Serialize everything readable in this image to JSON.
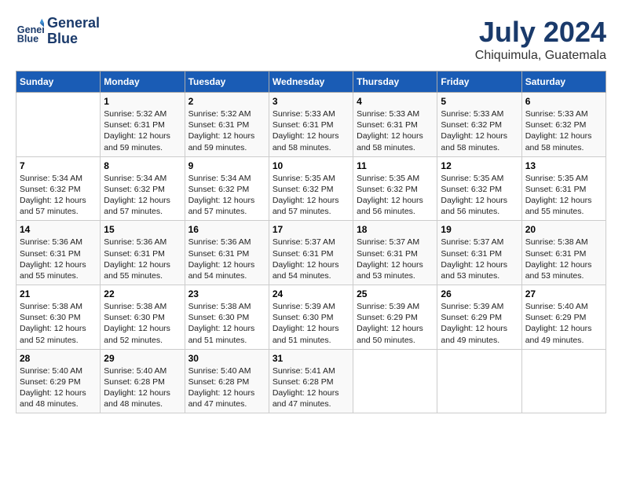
{
  "header": {
    "logo_line1": "General",
    "logo_line2": "Blue",
    "month_title": "July 2024",
    "location": "Chiquimula, Guatemala"
  },
  "days_of_week": [
    "Sunday",
    "Monday",
    "Tuesday",
    "Wednesday",
    "Thursday",
    "Friday",
    "Saturday"
  ],
  "weeks": [
    [
      {
        "day": "",
        "info": ""
      },
      {
        "day": "1",
        "info": "Sunrise: 5:32 AM\nSunset: 6:31 PM\nDaylight: 12 hours\nand 59 minutes."
      },
      {
        "day": "2",
        "info": "Sunrise: 5:32 AM\nSunset: 6:31 PM\nDaylight: 12 hours\nand 59 minutes."
      },
      {
        "day": "3",
        "info": "Sunrise: 5:33 AM\nSunset: 6:31 PM\nDaylight: 12 hours\nand 58 minutes."
      },
      {
        "day": "4",
        "info": "Sunrise: 5:33 AM\nSunset: 6:31 PM\nDaylight: 12 hours\nand 58 minutes."
      },
      {
        "day": "5",
        "info": "Sunrise: 5:33 AM\nSunset: 6:32 PM\nDaylight: 12 hours\nand 58 minutes."
      },
      {
        "day": "6",
        "info": "Sunrise: 5:33 AM\nSunset: 6:32 PM\nDaylight: 12 hours\nand 58 minutes."
      }
    ],
    [
      {
        "day": "7",
        "info": "Sunrise: 5:34 AM\nSunset: 6:32 PM\nDaylight: 12 hours\nand 57 minutes."
      },
      {
        "day": "8",
        "info": "Sunrise: 5:34 AM\nSunset: 6:32 PM\nDaylight: 12 hours\nand 57 minutes."
      },
      {
        "day": "9",
        "info": "Sunrise: 5:34 AM\nSunset: 6:32 PM\nDaylight: 12 hours\nand 57 minutes."
      },
      {
        "day": "10",
        "info": "Sunrise: 5:35 AM\nSunset: 6:32 PM\nDaylight: 12 hours\nand 57 minutes."
      },
      {
        "day": "11",
        "info": "Sunrise: 5:35 AM\nSunset: 6:32 PM\nDaylight: 12 hours\nand 56 minutes."
      },
      {
        "day": "12",
        "info": "Sunrise: 5:35 AM\nSunset: 6:32 PM\nDaylight: 12 hours\nand 56 minutes."
      },
      {
        "day": "13",
        "info": "Sunrise: 5:35 AM\nSunset: 6:31 PM\nDaylight: 12 hours\nand 55 minutes."
      }
    ],
    [
      {
        "day": "14",
        "info": "Sunrise: 5:36 AM\nSunset: 6:31 PM\nDaylight: 12 hours\nand 55 minutes."
      },
      {
        "day": "15",
        "info": "Sunrise: 5:36 AM\nSunset: 6:31 PM\nDaylight: 12 hours\nand 55 minutes."
      },
      {
        "day": "16",
        "info": "Sunrise: 5:36 AM\nSunset: 6:31 PM\nDaylight: 12 hours\nand 54 minutes."
      },
      {
        "day": "17",
        "info": "Sunrise: 5:37 AM\nSunset: 6:31 PM\nDaylight: 12 hours\nand 54 minutes."
      },
      {
        "day": "18",
        "info": "Sunrise: 5:37 AM\nSunset: 6:31 PM\nDaylight: 12 hours\nand 53 minutes."
      },
      {
        "day": "19",
        "info": "Sunrise: 5:37 AM\nSunset: 6:31 PM\nDaylight: 12 hours\nand 53 minutes."
      },
      {
        "day": "20",
        "info": "Sunrise: 5:38 AM\nSunset: 6:31 PM\nDaylight: 12 hours\nand 53 minutes."
      }
    ],
    [
      {
        "day": "21",
        "info": "Sunrise: 5:38 AM\nSunset: 6:30 PM\nDaylight: 12 hours\nand 52 minutes."
      },
      {
        "day": "22",
        "info": "Sunrise: 5:38 AM\nSunset: 6:30 PM\nDaylight: 12 hours\nand 52 minutes."
      },
      {
        "day": "23",
        "info": "Sunrise: 5:38 AM\nSunset: 6:30 PM\nDaylight: 12 hours\nand 51 minutes."
      },
      {
        "day": "24",
        "info": "Sunrise: 5:39 AM\nSunset: 6:30 PM\nDaylight: 12 hours\nand 51 minutes."
      },
      {
        "day": "25",
        "info": "Sunrise: 5:39 AM\nSunset: 6:29 PM\nDaylight: 12 hours\nand 50 minutes."
      },
      {
        "day": "26",
        "info": "Sunrise: 5:39 AM\nSunset: 6:29 PM\nDaylight: 12 hours\nand 49 minutes."
      },
      {
        "day": "27",
        "info": "Sunrise: 5:40 AM\nSunset: 6:29 PM\nDaylight: 12 hours\nand 49 minutes."
      }
    ],
    [
      {
        "day": "28",
        "info": "Sunrise: 5:40 AM\nSunset: 6:29 PM\nDaylight: 12 hours\nand 48 minutes."
      },
      {
        "day": "29",
        "info": "Sunrise: 5:40 AM\nSunset: 6:28 PM\nDaylight: 12 hours\nand 48 minutes."
      },
      {
        "day": "30",
        "info": "Sunrise: 5:40 AM\nSunset: 6:28 PM\nDaylight: 12 hours\nand 47 minutes."
      },
      {
        "day": "31",
        "info": "Sunrise: 5:41 AM\nSunset: 6:28 PM\nDaylight: 12 hours\nand 47 minutes."
      },
      {
        "day": "",
        "info": ""
      },
      {
        "day": "",
        "info": ""
      },
      {
        "day": "",
        "info": ""
      }
    ]
  ]
}
